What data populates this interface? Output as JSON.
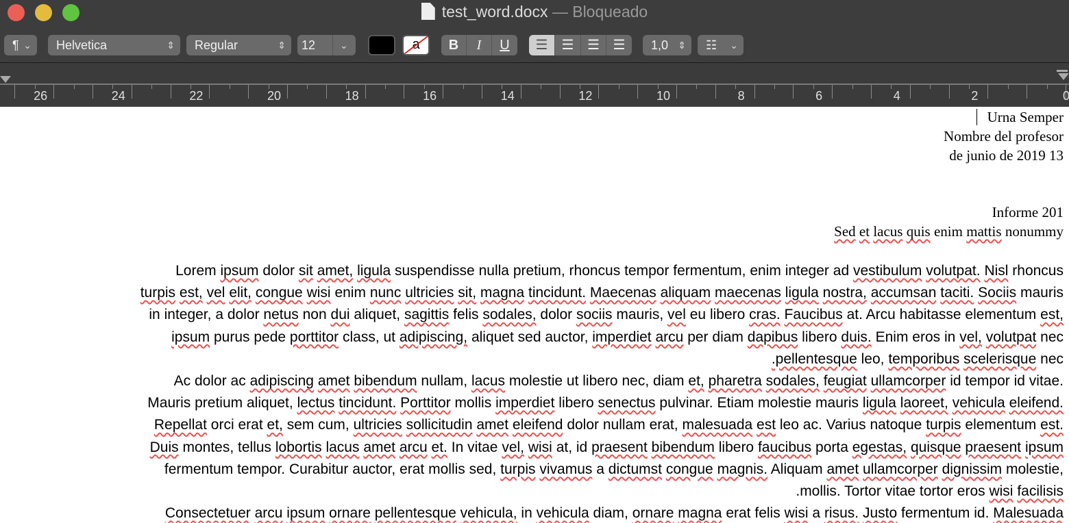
{
  "window": {
    "filename": "test_word.docx",
    "status": "— Bloqueado",
    "traffic_colors": [
      "#ec5f57",
      "#e2bb3f",
      "#5fc43f"
    ]
  },
  "toolbar": {
    "paragraph_style": "¶",
    "font_family": "Helvetica",
    "font_style": "Regular",
    "font_size": "12",
    "text_color": "#000000",
    "highlight_label": "a",
    "bold": "B",
    "italic": "I",
    "underline": "U",
    "alignment_selected": "left",
    "line_spacing": "1,0",
    "list_icon": "list-icon"
  },
  "ruler": {
    "labels": [
      26,
      24,
      22,
      20,
      18,
      16,
      14,
      12,
      10,
      8,
      6,
      4,
      2,
      0
    ]
  },
  "document": {
    "header": [
      "Urna Semper",
      "Nombre del profesor",
      "de junio de 2019 13"
    ],
    "title": [
      "Informe 201",
      "Sed et lacus quis enim mattis nonummy"
    ],
    "lines": [
      "Lorem ipsum dolor sit amet, ligula suspendisse nulla pretium, rhoncus tempor fermentum, enim integer ad vestibulum volutpat. Nisl rhoncus",
      "turpis est, vel elit, congue wisi enim nunc ultricies sit, magna tincidunt. Maecenas aliquam maecenas ligula nostra, accumsan taciti. Sociis mauris",
      "in integer, a dolor netus non dui aliquet, sagittis felis sodales, dolor sociis mauris, vel eu libero cras. Faucibus at. Arcu habitasse elementum est,",
      "ipsum purus pede porttitor class, ut adipiscing, aliquet sed auctor, imperdiet arcu per diam dapibus libero duis. Enim eros in vel, volutpat nec",
      ".pellentesque leo, temporibus scelerisque nec",
      "Ac dolor ac adipiscing amet bibendum nullam, lacus molestie ut libero nec, diam et, pharetra sodales, feugiat ullamcorper id tempor id vitae.",
      "Mauris pretium aliquet, lectus tincidunt. Porttitor mollis imperdiet libero senectus pulvinar. Etiam molestie mauris ligula laoreet, vehicula eleifend.",
      "Repellat orci erat et, sem cum, ultricies sollicitudin amet eleifend dolor nullam erat, malesuada est leo ac. Varius natoque turpis elementum est.",
      "Duis montes, tellus lobortis lacus amet arcu et. In vitae vel, wisi at, id praesent bibendum libero faucibus porta egestas, quisque praesent ipsum",
      "fermentum tempor. Curabitur auctor, erat mollis sed, turpis vivamus a dictumst congue magnis. Aliquam amet ullamcorper dignissim molestie,",
      ".mollis. Tortor vitae tortor eros wisi facilisis",
      "Consectetuer arcu ipsum ornare pellentesque vehicula, in vehicula diam, ornare magna erat felis wisi a risus. Justo fermentum id. Malesuada"
    ]
  }
}
